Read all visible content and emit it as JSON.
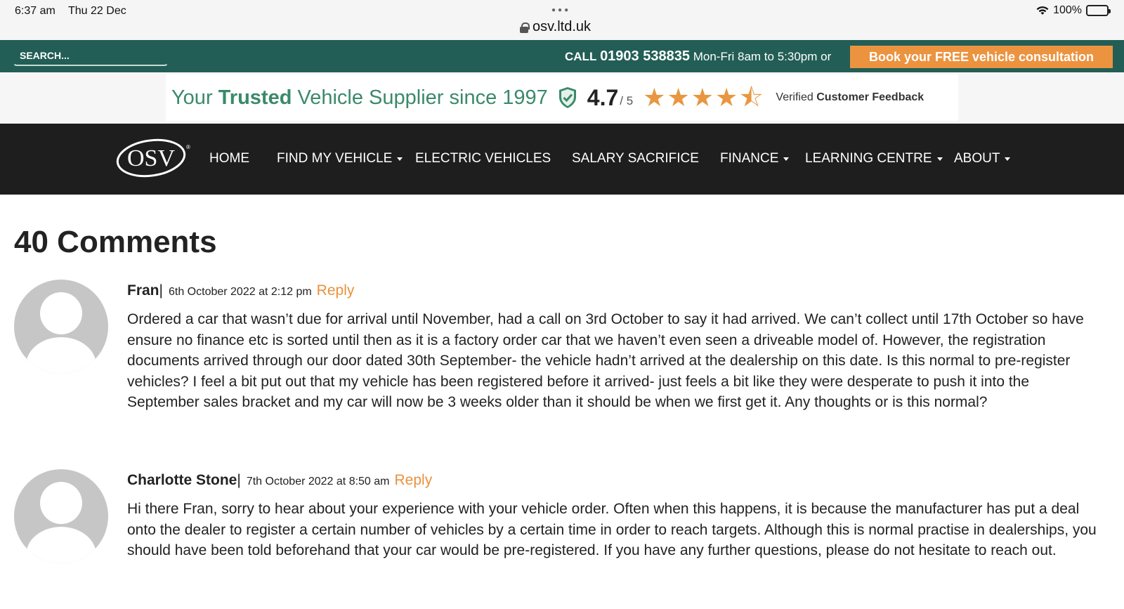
{
  "status_bar": {
    "time": "6:37 am",
    "date": "Thu 22 Dec",
    "url": "osv.ltd.uk",
    "battery": "100%"
  },
  "top_bar": {
    "search_placeholder": "SEARCH...",
    "call_label": "CALL",
    "phone": "01903 538835",
    "hours": "Mon-Fri 8am to 5:30pm or",
    "book_button": "Book your FREE vehicle consultation"
  },
  "trust_banner": {
    "text_prefix": "Your",
    "text_bold": "Trusted",
    "text_suffix": "Vehicle Supplier since 1997",
    "rating": "4.7",
    "rating_max": "/ 5",
    "stars": 4.5,
    "verified_prefix": "Verified",
    "verified_bold": "Customer Feedback"
  },
  "nav": {
    "logo_text": "OSV",
    "items": [
      {
        "label": "HOME"
      },
      {
        "label": "FIND MY VEHICLE"
      },
      {
        "label": "ELECTRIC VEHICLES"
      },
      {
        "label": "SALARY SACRIFICE"
      },
      {
        "label": "FINANCE"
      },
      {
        "label": "LEARNING CENTRE"
      },
      {
        "label": "ABOUT"
      }
    ]
  },
  "comments": {
    "title": "40 Comments",
    "items": [
      {
        "author": "Fran",
        "date": "6th October 2022 at 2:12 pm",
        "reply": "Reply",
        "body": "Ordered a car that wasn’t due for arrival until November, had a call on 3rd October to say it had arrived. We can’t collect until 17th October so have ensure no finance etc is sorted until then as it is a factory order car that we haven’t even seen a driveable model of. However, the registration documents arrived through our door dated 30th September- the vehicle hadn’t arrived at the dealership on this date. Is this normal to pre-register vehicles? I feel a bit put out that my vehicle has been registered before it arrived- just feels a bit like they were desperate to push it into the September sales bracket and my car will now be 3 weeks older than it should be when we first get it. Any thoughts or is this normal?"
      },
      {
        "author": "Charlotte Stone",
        "date": "7th October 2022 at 8:50 am",
        "reply": "Reply",
        "body": "Hi there Fran, sorry to hear about your experience with your vehicle order. Often when this happens, it is because the manufacturer has put a deal onto the dealer to register a certain number of vehicles by a certain time in order to reach targets. Although this is normal practise in dealerships, you should have been told beforehand that your car would be pre-registered. If you have any further questions, please do not hesitate to reach out."
      }
    ]
  },
  "colors": {
    "top_bar": "#225e55",
    "accent_orange": "#ec9340",
    "nav_bg": "#1e1e1e",
    "trust_green": "#3a8a6a"
  }
}
